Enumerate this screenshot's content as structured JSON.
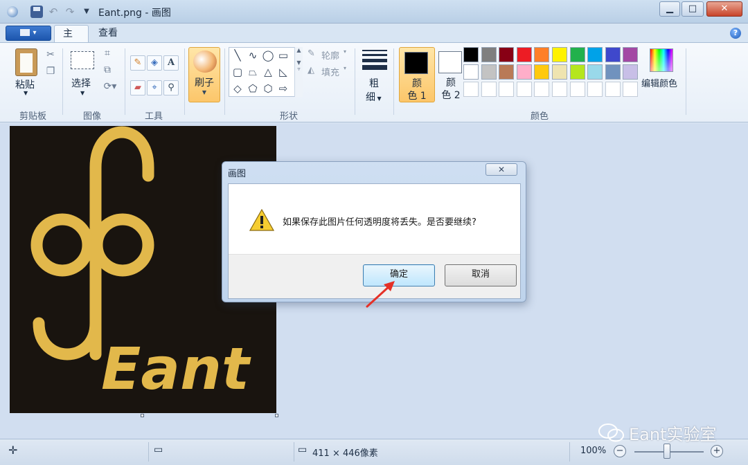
{
  "window": {
    "title": "Eant.png - 画图",
    "controls": {
      "minimize": "▁",
      "maximize": "□",
      "close": "✕"
    }
  },
  "ribbon": {
    "tabs": [
      {
        "label": "主页",
        "active": true
      },
      {
        "label": "查看",
        "active": false
      }
    ],
    "groups": {
      "clipboard": {
        "label": "剪贴板",
        "paste": "粘贴"
      },
      "image": {
        "label": "图像",
        "select": "选择"
      },
      "tools": {
        "label": "工具"
      },
      "brushes": {
        "label": "刷子"
      },
      "shapes": {
        "label": "形状",
        "outline": "轮廓",
        "fill": "填充"
      },
      "size": {
        "label_1": "粗",
        "label_2": "细"
      },
      "colors": {
        "label": "颜色",
        "color1_label_1": "颜",
        "color1_label_2": "色 1",
        "color2_label_1": "颜",
        "color2_label_2": "色 2",
        "color1_value": "#000000",
        "color2_value": "#ffffff",
        "edit_colors": "编辑颜色",
        "palette_row1": [
          "#000000",
          "#7f7f7f",
          "#880015",
          "#ed1c24",
          "#ff7f27",
          "#fff200",
          "#22b14c",
          "#00a2e8",
          "#3f48cc",
          "#a349a4"
        ],
        "palette_row2": [
          "#ffffff",
          "#c3c3c3",
          "#b97a57",
          "#ffaec9",
          "#ffc90e",
          "#efe4b0",
          "#b5e61d",
          "#99d9ea",
          "#7092be",
          "#c8bfe7"
        ],
        "palette_row3": [
          "#ffffff",
          "#ffffff",
          "#ffffff",
          "#ffffff",
          "#ffffff",
          "#ffffff",
          "#ffffff",
          "#ffffff",
          "#ffffff",
          "#ffffff"
        ]
      }
    }
  },
  "canvas": {
    "background": "#19140f",
    "logo_color": "#e2b84b",
    "logo_text": "Eant"
  },
  "dialog": {
    "title": "画图",
    "close": "✕",
    "message": "如果保存此图片任何透明度将丢失。是否要继续?",
    "ok_label": "确定",
    "cancel_label": "取消"
  },
  "statusbar": {
    "image_size": "411 × 446像素",
    "zoom": "100%",
    "zoom_minus": "−",
    "zoom_plus": "+"
  },
  "watermark": {
    "text": "Eant实验室"
  }
}
